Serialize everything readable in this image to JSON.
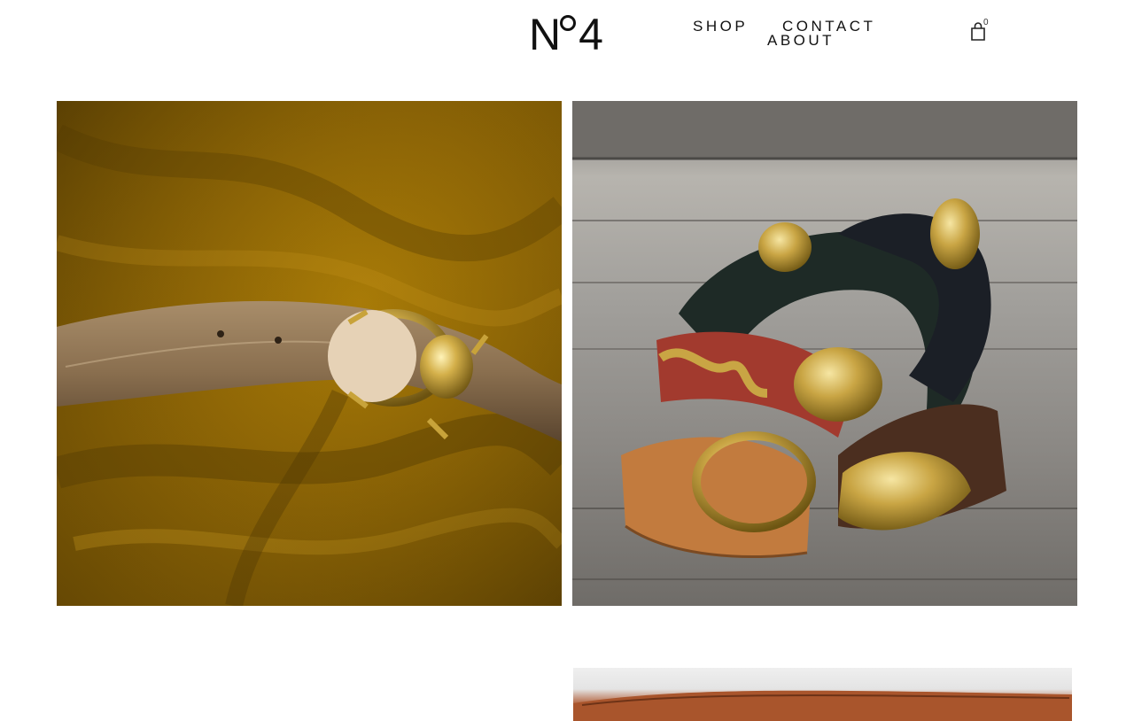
{
  "brand": {
    "logo_letter": "N",
    "logo_digit": "4"
  },
  "nav": {
    "shop": "SHOP",
    "contact": "CONTACT",
    "about": "ABOUT"
  },
  "cart": {
    "icon": "shopping-bag-icon",
    "count": "0"
  },
  "gallery": {
    "items": [
      {
        "name": "python-belt-beetle-buckle-photo"
      },
      {
        "name": "leather-belts-animal-buckles-photo"
      },
      {
        "name": "embossed-leather-belt-photo"
      }
    ]
  },
  "colors": {
    "text": "#111111",
    "mustard_fabric": "#8c6405",
    "wood_gray": "#a19f9b",
    "tan_leather": "#b05a31"
  }
}
